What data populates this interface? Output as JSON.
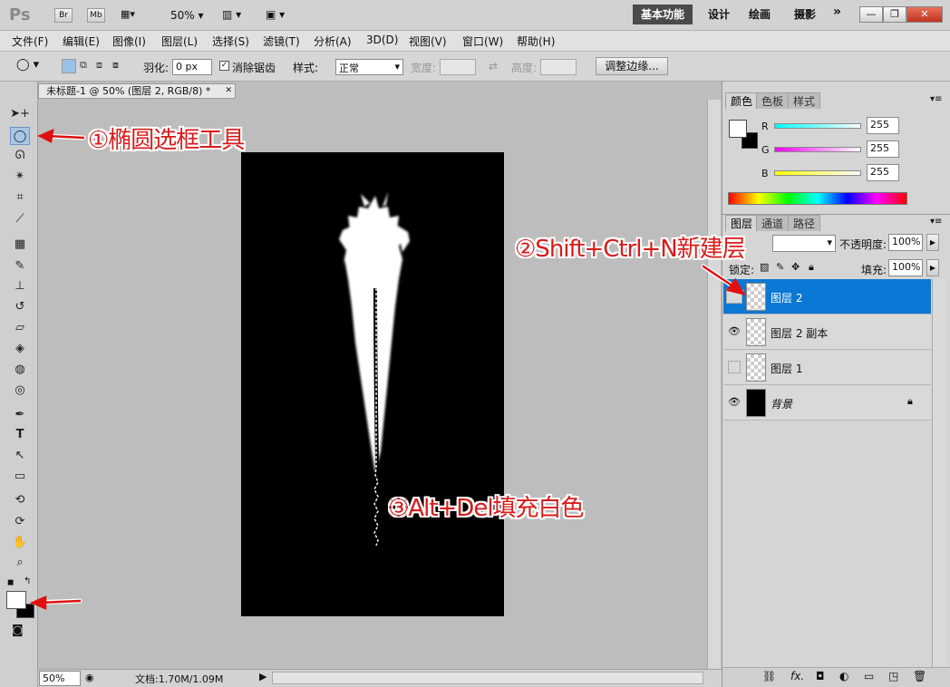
{
  "app": {
    "logo": "Ps",
    "bridge": "Br",
    "minibridge": "Mb",
    "zoom": "50%"
  },
  "workspace": {
    "active": "基本功能",
    "items": [
      "设计",
      "绘画",
      "摄影"
    ],
    "more": "»"
  },
  "window_controls": {
    "minimize": "—",
    "restore": "❐",
    "close": "✕"
  },
  "menu": [
    "文件(F)",
    "编辑(E)",
    "图像(I)",
    "图层(L)",
    "选择(S)",
    "滤镜(T)",
    "分析(A)",
    "3D(D)",
    "视图(V)",
    "窗口(W)",
    "帮助(H)"
  ],
  "options": {
    "feather_label": "羽化:",
    "feather_value": "0 px",
    "antialias_label": "消除锯齿",
    "antialias_checked": true,
    "style_label": "样式:",
    "style_value": "正常",
    "width_label": "宽度:",
    "height_label": "高度:",
    "refine_edge": "调整边缘..."
  },
  "document": {
    "tab_title": "未标题-1 @ 50% (图层 2, RGB/8) *",
    "close": "✕",
    "zoom": "50%",
    "doc_size": "文档:1.70M/1.09M"
  },
  "color_panel": {
    "tabs": [
      "颜色",
      "色板",
      "样式"
    ],
    "channels": [
      {
        "label": "R",
        "value": "255",
        "gradient": "#00ffff"
      },
      {
        "label": "G",
        "value": "255",
        "gradient": "#ff00ff"
      },
      {
        "label": "B",
        "value": "255",
        "gradient": "#ffff00"
      }
    ]
  },
  "layers_panel": {
    "tabs": [
      "图层",
      "通道",
      "路径"
    ],
    "opacity_label": "不透明度:",
    "opacity_value": "100%",
    "lock_label": "锁定:",
    "fill_label": "填充:",
    "fill_value": "100%",
    "layers": [
      {
        "name": "图层 2",
        "selected": true,
        "visible": false
      },
      {
        "name": "图层 2 副本",
        "selected": false,
        "visible": true
      },
      {
        "name": "图层 1",
        "selected": false,
        "visible": false
      },
      {
        "name": "背景",
        "selected": false,
        "visible": true,
        "locked": true
      }
    ]
  },
  "annotations": [
    "①椭圆选框工具",
    "②Shift+Ctrl+N新建层",
    "③Alt+Del填充白色"
  ],
  "icons": {
    "marquee": "ellipse-marquee-icon",
    "move": "move-icon",
    "lasso": "lasso-icon",
    "eye": "eye-icon",
    "lock": "lock-icon"
  },
  "colors": {
    "accent": "#0a78d4",
    "annotation": "#d91c1c"
  }
}
